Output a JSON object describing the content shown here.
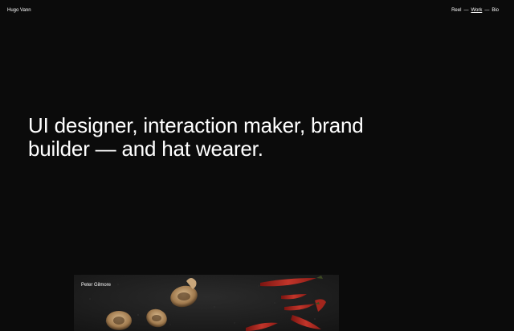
{
  "header": {
    "site_name": "Hugo Vann",
    "nav": {
      "reel": "Reel",
      "separator": "—",
      "work": "Work",
      "bio": "Bio"
    }
  },
  "hero": {
    "line1": "UI designer, interaction maker, brand",
    "line2": "builder — and hat wearer."
  },
  "project": {
    "label": "Peter Gilmore",
    "image_icon": "food-photo-mushrooms-chilies"
  },
  "colors": {
    "background": "#0b0b0b",
    "text": "#ffffff",
    "accent_chili": "#b3271e"
  }
}
